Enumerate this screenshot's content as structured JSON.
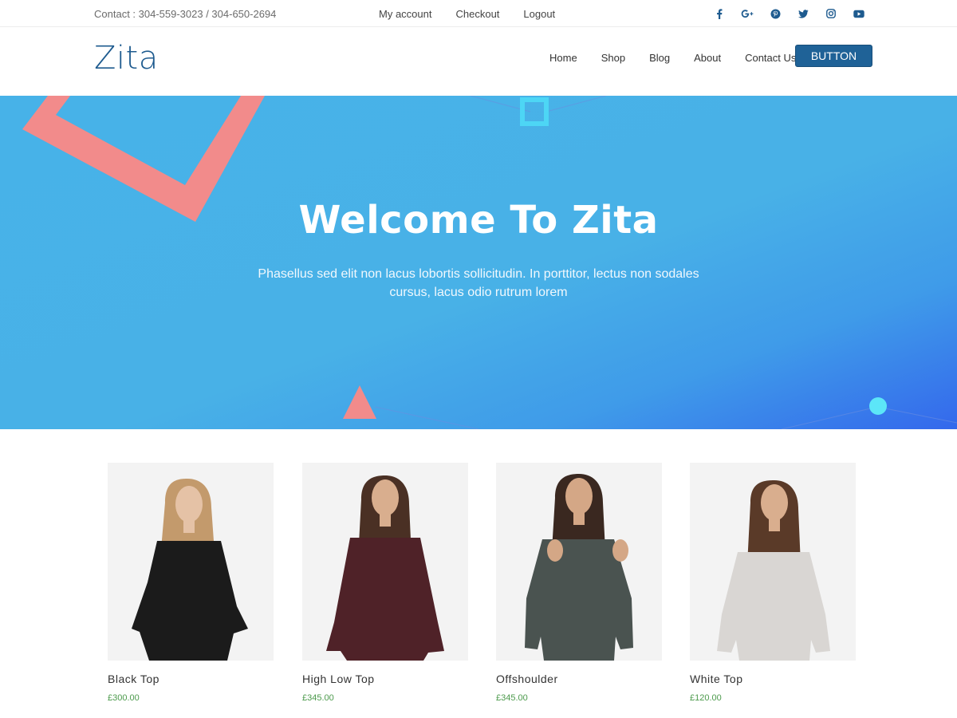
{
  "topbar": {
    "contact": "Contact : 304-559-3023 / 304-650-2694",
    "links": [
      "My account",
      "Checkout",
      "Logout"
    ],
    "social_icons": [
      "facebook-icon",
      "google-plus-icon",
      "pinterest-icon",
      "twitter-icon",
      "instagram-icon",
      "youtube-icon"
    ]
  },
  "header": {
    "logo": "Zita",
    "nav": [
      "Home",
      "Shop",
      "Blog",
      "About",
      "Contact Us"
    ],
    "button": "BUTTON"
  },
  "hero": {
    "title": "Welcome To Zita",
    "text": "Phasellus sed elit non lacus lobortis sollicitudin. In porttitor, lectus non sodales cursus, lacus odio rutrum lorem"
  },
  "products": [
    {
      "name": "Black Top",
      "price": "£300.00",
      "color": "#1b1b1b"
    },
    {
      "name": "High Low Top",
      "price": "£345.00",
      "color": "#4f2228"
    },
    {
      "name": "Offshoulder",
      "price": "£345.00",
      "color": "#4a5350"
    },
    {
      "name": "White Top",
      "price": "£120.00",
      "color": "#d9d6d3"
    }
  ],
  "colors": {
    "brand": "#1e5b8f",
    "button": "#1f6297",
    "hero": "#48b1e7",
    "price": "#4c9a4c",
    "accent_pink": "#f28b8b",
    "accent_cyan": "#4dd6f5"
  }
}
